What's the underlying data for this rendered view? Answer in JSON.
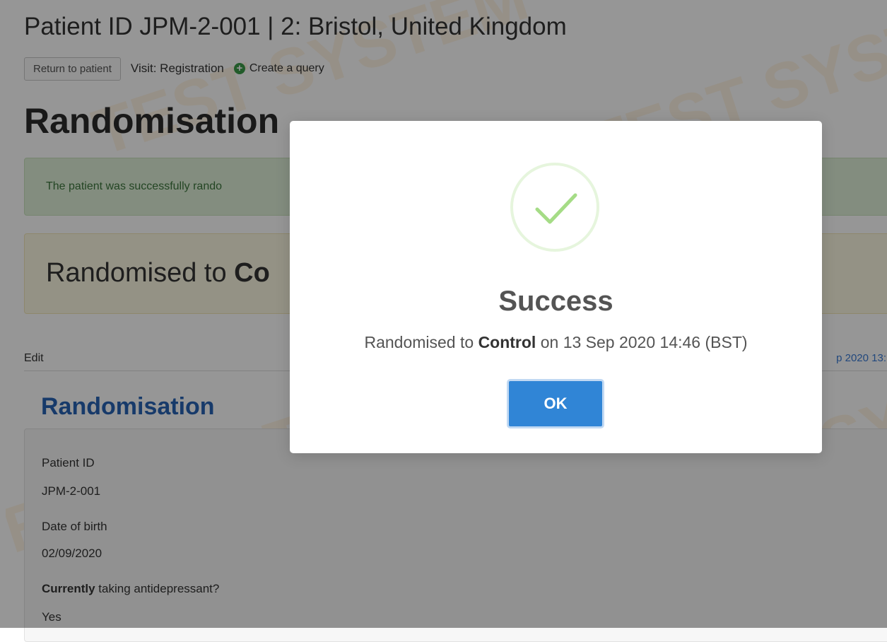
{
  "header": {
    "patient_title": "Patient ID JPM-2-001 | 2: Bristol, United Kingdom",
    "return_button": "Return to patient",
    "visit_label": "Visit: Registration",
    "create_query": "Create a query"
  },
  "main": {
    "heading": "Randomisation",
    "alert_text": "The patient was successfully rando",
    "result_prefix": "Randomised to ",
    "result_arm": "Co",
    "edit_label": "Edit",
    "edit_date": "p 2020 13:",
    "section_title": "Randomisation",
    "fields": [
      {
        "label": "Patient ID",
        "value": "JPM-2-001"
      },
      {
        "label": "Date of birth",
        "value": "02/09/2020"
      },
      {
        "label_bold": "Currently",
        "label_rest": " taking antidepressant?",
        "value": "Yes"
      }
    ]
  },
  "watermark": {
    "text": "TEST SYSTEM"
  },
  "modal": {
    "icon": "checkmark-icon",
    "title": "Success",
    "message_prefix": "Randomised to ",
    "message_arm": "Control",
    "message_suffix": " on 13 Sep 2020 14:46 (BST)",
    "ok_label": "OK"
  },
  "colors": {
    "primary": "#3085d6",
    "success_check": "#a5dc86",
    "section_blue": "#2864b5",
    "alert_green_bg": "#dff0d8",
    "result_yellow_bg": "#fcf8e3"
  }
}
